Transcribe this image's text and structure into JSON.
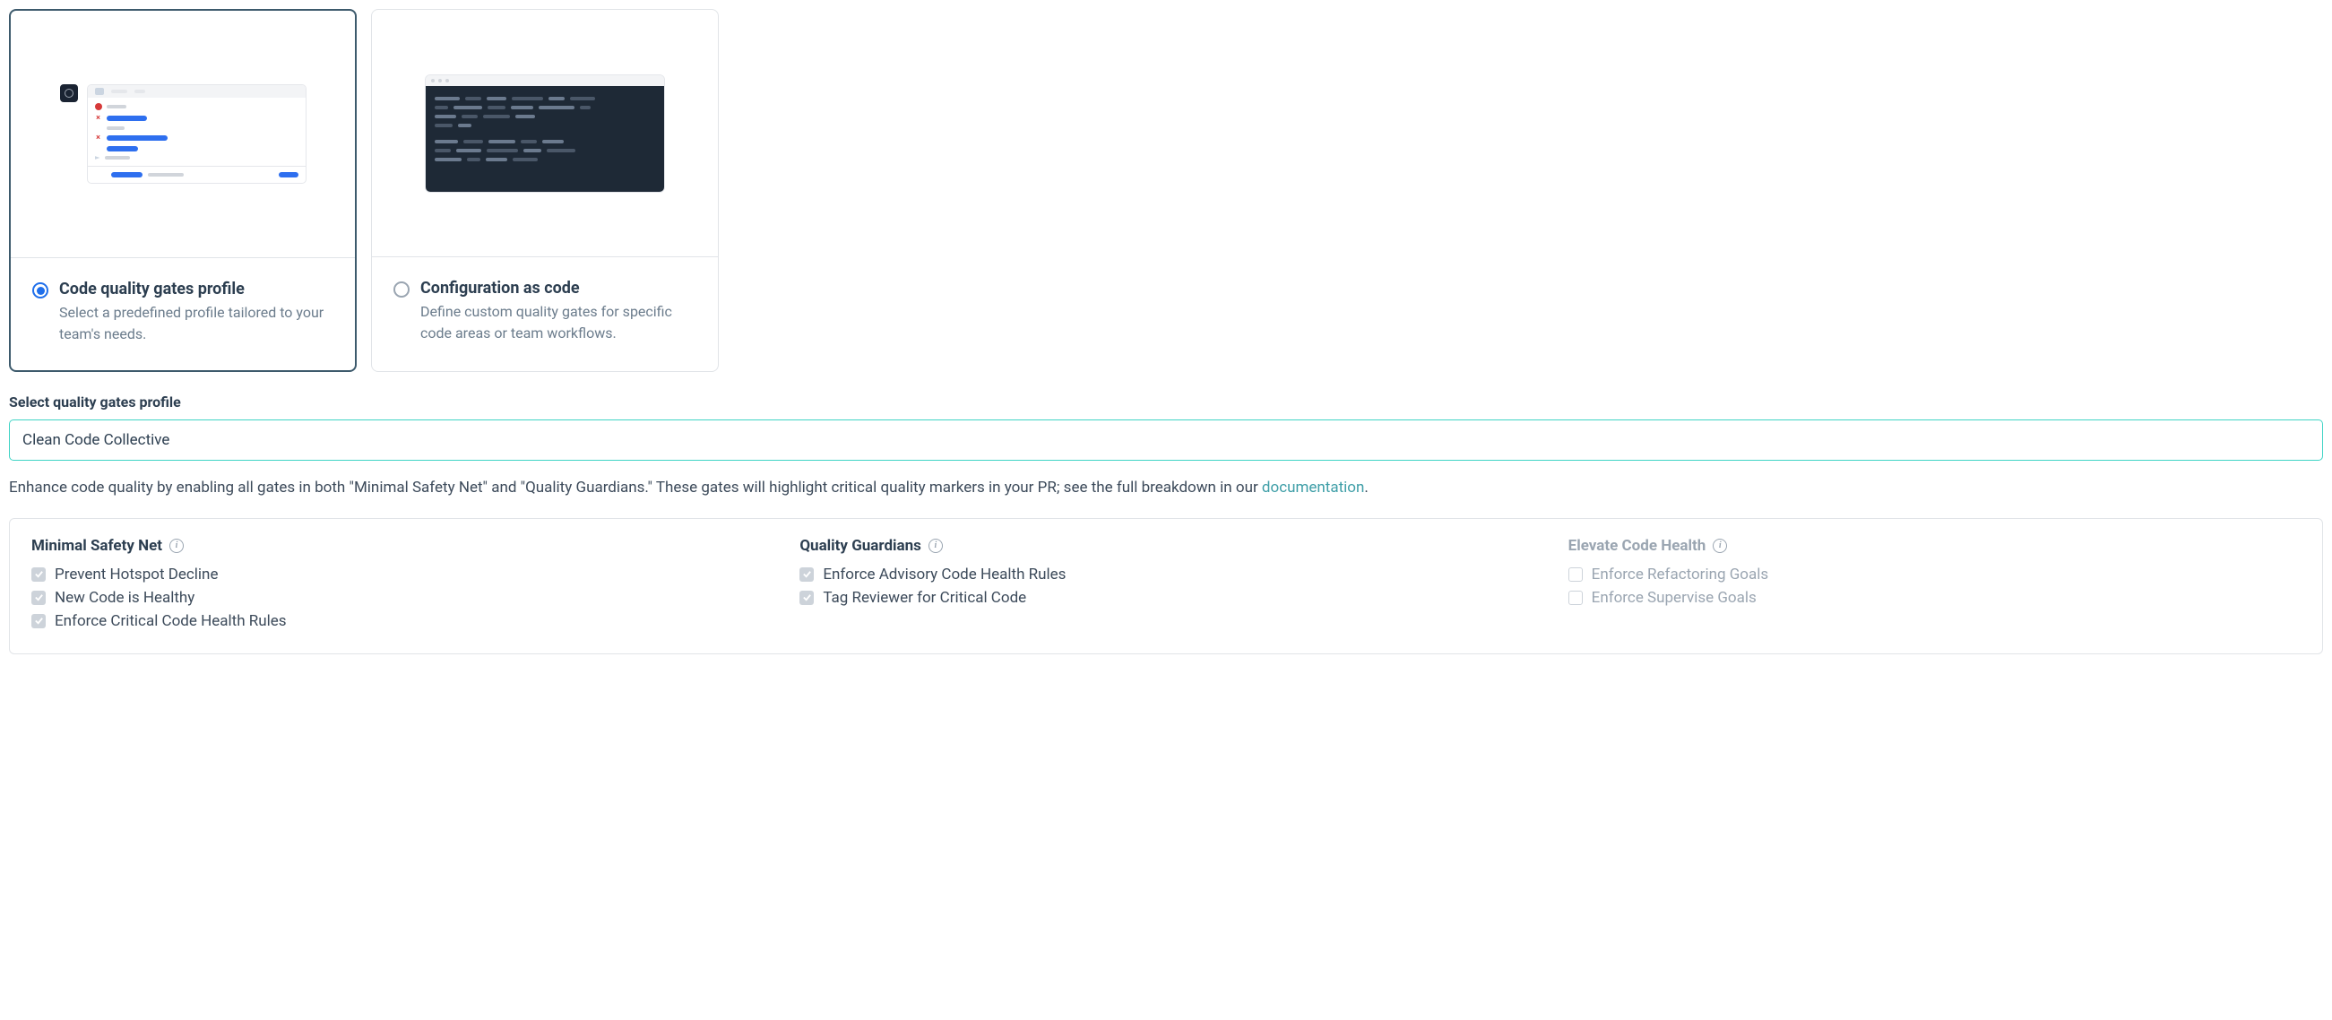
{
  "cards": {
    "profile": {
      "title": "Code quality gates profile",
      "desc": "Select a predefined profile tailored to your team's needs."
    },
    "config_as_code": {
      "title": "Configuration as code",
      "desc": "Define custom quality gates for specific code areas or team workflows."
    }
  },
  "profile_selector": {
    "label": "Select quality gates profile",
    "value": "Clean Code Collective"
  },
  "description": {
    "text_before": "Enhance code quality by enabling all gates in both \"Minimal Safety Net\" and \"Quality Guardians.\" These gates will highlight critical quality markers in your PR; see the full breakdown in our ",
    "link_text": "documentation",
    "text_after": "."
  },
  "gate_columns": {
    "minimal": {
      "title": "Minimal Safety Net",
      "items": [
        "Prevent Hotspot Decline",
        "New Code is Healthy",
        "Enforce Critical Code Health Rules"
      ]
    },
    "guardians": {
      "title": "Quality Guardians",
      "items": [
        "Enforce Advisory Code Health Rules",
        "Tag Reviewer for Critical Code"
      ]
    },
    "elevate": {
      "title": "Elevate Code Health",
      "items": [
        "Enforce Refactoring Goals",
        "Enforce Supervise Goals"
      ]
    }
  }
}
